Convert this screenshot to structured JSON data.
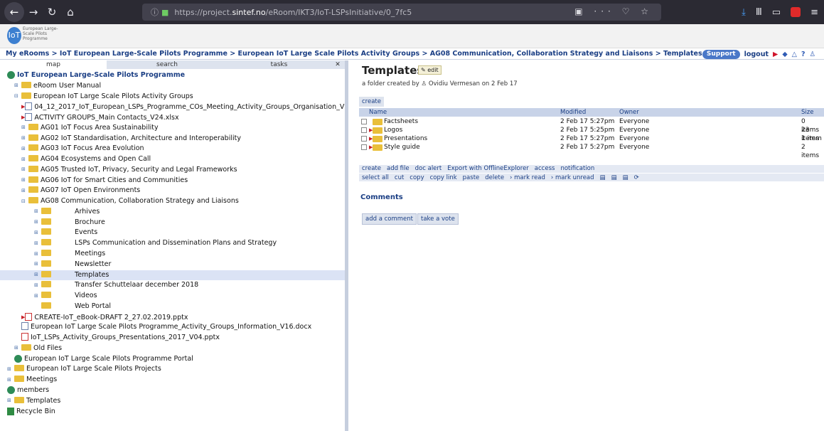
{
  "browser": {
    "url_prefix": "https://project.",
    "url_domain": "sintef.no",
    "url_path": "/eRoom/IKT3/IoT-LSPsInitiative/0_7fc5",
    "url_right_icons": "▣ ··· ♡ ☆"
  },
  "logo": {
    "text": "IoT",
    "subtitle": "European Large-Scale Pilots Programme"
  },
  "breadcrumb": "My eRooms > IoT European Large-Scale Pilots Programme > European IoT Large Scale Pilots Activity Groups > AG08 Communication, Collaboration Strategy and Liaisons > Templates",
  "header_right": {
    "support": "Support",
    "logout": "logout"
  },
  "left_tabs": {
    "map": "map",
    "search": "search",
    "tasks": "tasks",
    "close": "✕"
  },
  "tree": [
    {
      "indent": 0,
      "icon": "globe",
      "label": "IoT European Large-Scale Pilots Programme",
      "bold": true
    },
    {
      "indent": 1,
      "icon": "folder",
      "exp": "⊞",
      "label": "eRoom User Manual"
    },
    {
      "indent": 1,
      "icon": "folder",
      "exp": "⊟",
      "label": "European IoT Large Scale Pilots Activity Groups"
    },
    {
      "indent": 2,
      "icon": "doc",
      "arrow": true,
      "label": "04_12_2017_IoT_European_LSPs_Programme_COs_Meeting_Activity_Groups_Organisation_V01.docx"
    },
    {
      "indent": 2,
      "icon": "doc",
      "arrow": true,
      "label": "ACTIVITY GROUPS_Main Contacts_V24.xlsx"
    },
    {
      "indent": 2,
      "icon": "folder",
      "exp": "⊞",
      "label": "AG01 IoT Focus Area Sustainability"
    },
    {
      "indent": 2,
      "icon": "folder",
      "exp": "⊞",
      "label": "AG02 IoT Standardisation, Architecture and Interoperability"
    },
    {
      "indent": 2,
      "icon": "folder",
      "exp": "⊞",
      "label": "AG03 IoT Focus Area Evolution"
    },
    {
      "indent": 2,
      "icon": "folder",
      "exp": "⊞",
      "label": "AG04 Ecosystems and Open Call"
    },
    {
      "indent": 2,
      "icon": "folder",
      "exp": "⊞",
      "label": "AG05 Trusted IoT, Privacy, Security and Legal Frameworks"
    },
    {
      "indent": 2,
      "icon": "folder",
      "exp": "⊞",
      "label": "AG06 IoT for Smart Cities and Communities"
    },
    {
      "indent": 2,
      "icon": "folder",
      "exp": "⊞",
      "label": "AG07 IoT Open Environments"
    },
    {
      "indent": 2,
      "icon": "folder",
      "exp": "⊟",
      "label": "AG08 Communication, Collaboration Strategy and Liaisons"
    },
    {
      "indent": 3,
      "icon": "folder",
      "exp": "⊞",
      "label": "Arhives"
    },
    {
      "indent": 3,
      "icon": "folder",
      "exp": "⊞",
      "label": "Brochure"
    },
    {
      "indent": 3,
      "icon": "folder",
      "exp": "⊞",
      "label": "Events"
    },
    {
      "indent": 3,
      "icon": "folder",
      "exp": "⊞",
      "label": "LSPs Communication and Dissemination Plans and Strategy"
    },
    {
      "indent": 3,
      "icon": "folder",
      "exp": "⊞",
      "label": "Meetings"
    },
    {
      "indent": 3,
      "icon": "folder",
      "exp": "⊞",
      "label": "Newsletter"
    },
    {
      "indent": 3,
      "icon": "folder",
      "exp": "⊞",
      "label": "Templates",
      "selected": true
    },
    {
      "indent": 3,
      "icon": "folder",
      "exp": "⊞",
      "label": "Transfer Schuttelaar december 2018"
    },
    {
      "indent": 3,
      "icon": "folder",
      "exp": "⊞",
      "label": "Videos"
    },
    {
      "indent": 3,
      "icon": "folder",
      "exp": "",
      "label": "Web Portal"
    },
    {
      "indent": 2,
      "icon": "doc-red",
      "arrow": true,
      "label": "CREATE-IoT_eBook-DRAFT 2_27.02.2019.pptx"
    },
    {
      "indent": 2,
      "icon": "doc",
      "label": "European IoT Large Scale Pilots Programme_Activity_Groups_Information_V16.docx"
    },
    {
      "indent": 2,
      "icon": "doc-red",
      "label": "IoT_LSPs_Activity_Groups_Presentations_2017_V04.pptx"
    },
    {
      "indent": 1,
      "icon": "folder",
      "exp": "⊞",
      "label": "Old Files"
    },
    {
      "indent": 1,
      "icon": "globe",
      "label": "European IoT Large Scale Pilots Programme Portal"
    },
    {
      "indent": 0,
      "icon": "folder",
      "exp": "⊞",
      "label": "European IoT Large Scale Pilots Projects"
    },
    {
      "indent": 0,
      "icon": "folder",
      "exp": "⊞",
      "label": "Meetings"
    },
    {
      "indent": 0,
      "icon": "globe",
      "label": "members"
    },
    {
      "indent": 0,
      "icon": "folder",
      "exp": "⊞",
      "label": "Templates"
    },
    {
      "indent": 0,
      "icon": "bin",
      "label": "Recycle Bin"
    }
  ],
  "main": {
    "title": "Templates",
    "edit": "edit",
    "created_prefix": "a folder created by",
    "created_by": "Ovidiu Vermesan",
    "created_suffix": "on 2 Feb 17",
    "create_tab": "create",
    "columns": {
      "name": "Name",
      "modified": "Modified",
      "owner": "Owner",
      "size": "Size"
    },
    "rows": [
      {
        "name": "Factsheets",
        "modified": "2 Feb 17  5:27pm",
        "owner": "Everyone",
        "size": "0 items"
      },
      {
        "name": "Logos",
        "modified": "2 Feb 17  5:25pm",
        "owner": "Everyone",
        "size": "23 items"
      },
      {
        "name": "Presentations",
        "modified": "2 Feb 17  5:27pm",
        "owner": "Everyone",
        "size": "1 item"
      },
      {
        "name": "Style guide",
        "modified": "2 Feb 17  5:27pm",
        "owner": "Everyone",
        "size": "2 items"
      }
    ],
    "actions1": [
      "create",
      "add file",
      "doc alert",
      "Export with OfflineExplorer",
      "access",
      "notification"
    ],
    "actions2": [
      "select all",
      "cut",
      "copy",
      "copy link",
      "paste",
      "delete",
      "› mark read",
      "› mark unread"
    ],
    "comments_title": "Comments",
    "add_comment": "add a comment",
    "take_vote": "take a vote"
  }
}
